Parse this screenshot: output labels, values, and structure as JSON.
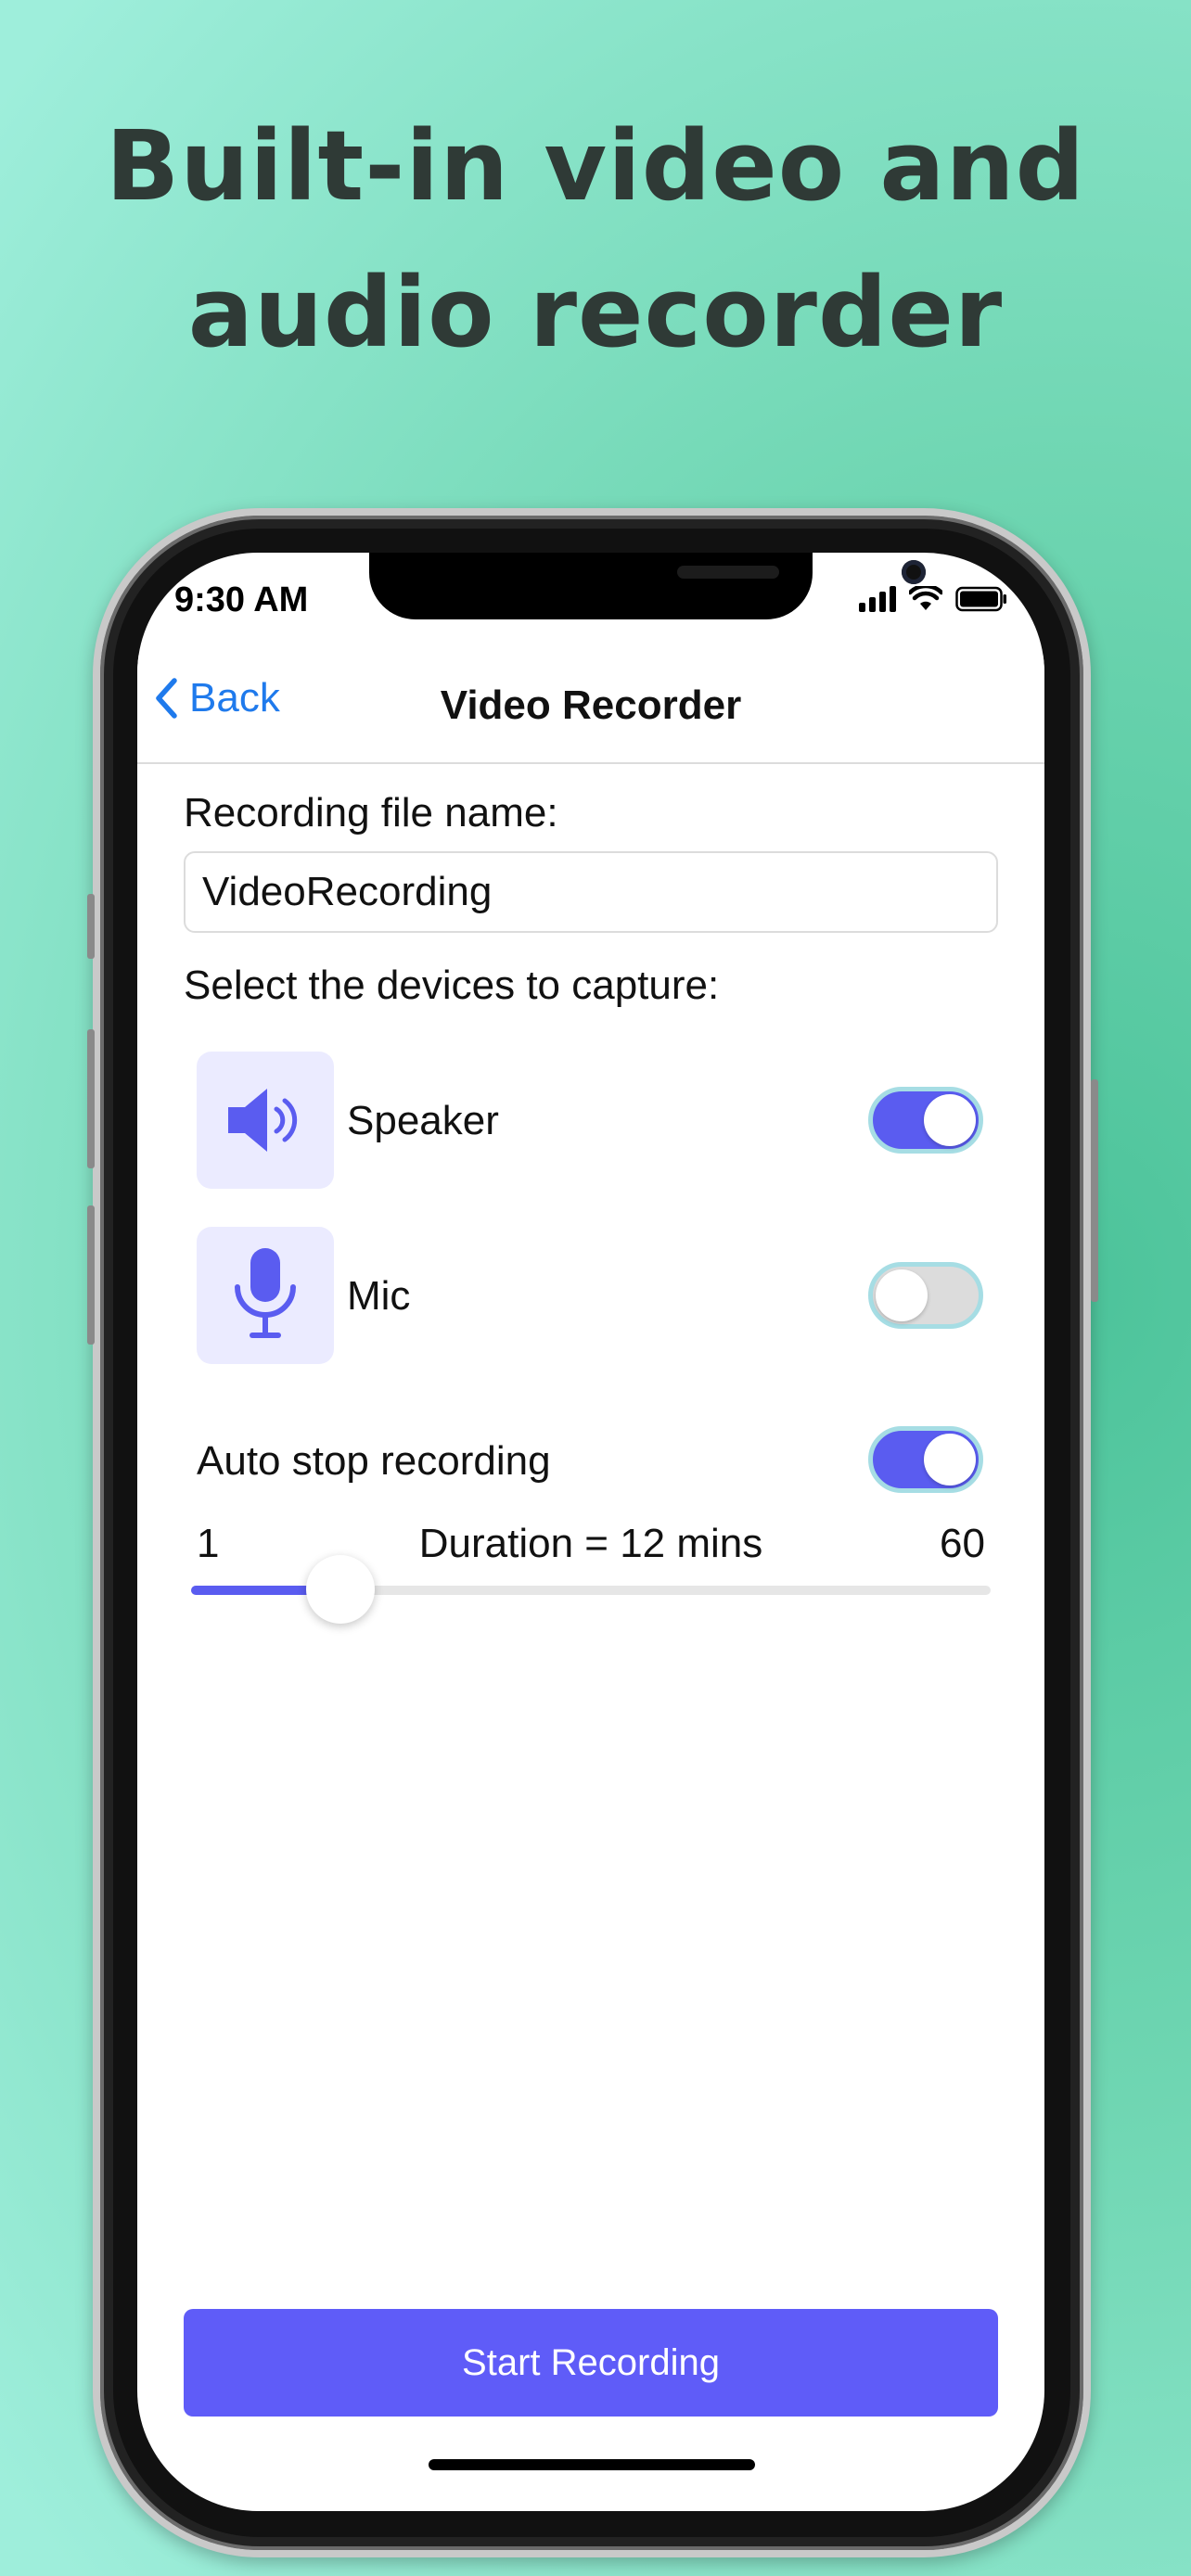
{
  "headline": [
    "Built-in video and",
    "audio recorder"
  ],
  "status_bar": {
    "time": "9:30 AM"
  },
  "navbar": {
    "back_label": "Back",
    "title": "Video Recorder"
  },
  "form": {
    "file_name_label": "Recording file name:",
    "file_name_value": "VideoRecording",
    "devices_label": "Select the devices to capture:"
  },
  "devices": [
    {
      "label": "Speaker",
      "icon": "speaker-icon",
      "enabled": true
    },
    {
      "label": "Mic",
      "icon": "microphone-icon",
      "enabled": false
    }
  ],
  "auto_stop": {
    "label": "Auto stop recording",
    "enabled": true
  },
  "duration_slider": {
    "min_label": "1",
    "max_label": "60",
    "min": 1,
    "max": 60,
    "value": 12,
    "caption": "Duration = 12 mins"
  },
  "start_button": {
    "label": "Start Recording"
  },
  "colors": {
    "accent": "#5a5cf0",
    "button": "#5f5cf8",
    "link": "#1f7aec",
    "background": "#6fd6b2"
  }
}
